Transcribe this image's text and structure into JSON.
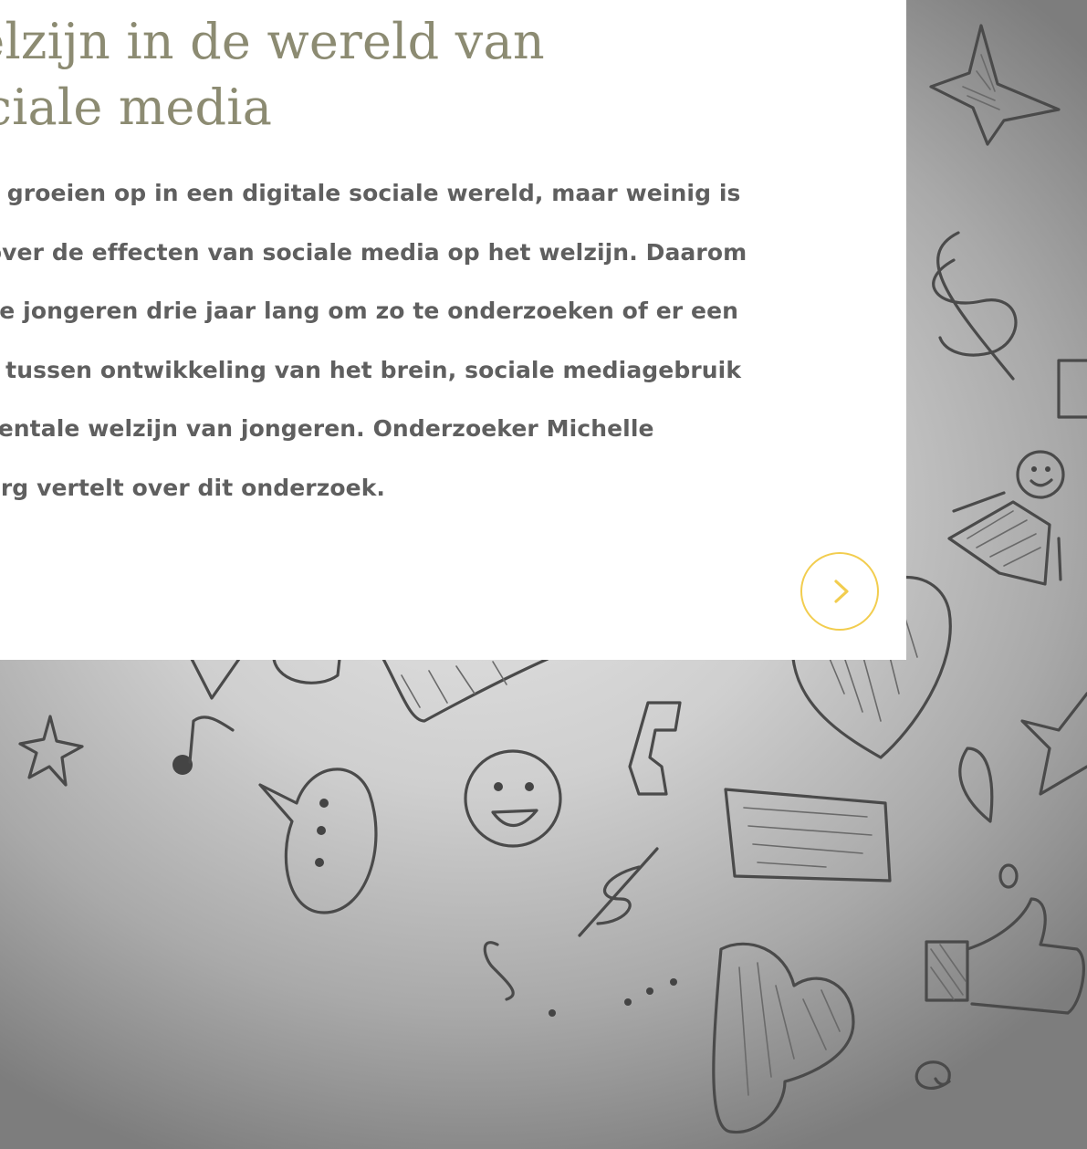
{
  "article": {
    "title": "Welzijn in de wereld van sociale media",
    "intro": "Jongeren groeien op in een digitale sociale wereld, maar weinig is bekend over de effecten van sociale media op het welzijn. Daarom volgen we jongeren drie jaar lang om zo te onderzoeken of er een relatie is tussen ontwikkeling van het brein, sociale mediagebruik en het mentale welzijn van jongeren. Onderzoeker Michelle Achterberg vertelt over dit onderzoek."
  },
  "navigation": {
    "next_icon": "chevron-right-icon"
  },
  "colors": {
    "title": "#8c8b72",
    "body_text": "#5f5f5f",
    "accent": "#f2cd4f",
    "card_background": "#ffffff"
  },
  "background": {
    "description_icons": [
      "star-icon",
      "dollar-icon",
      "smiley-icon",
      "heart-icon",
      "music-note-icon",
      "speech-bubble-icon",
      "phone-icon",
      "thumbs-up-icon",
      "question-mark-icon",
      "at-sign-icon",
      "exclamation-icon"
    ]
  }
}
